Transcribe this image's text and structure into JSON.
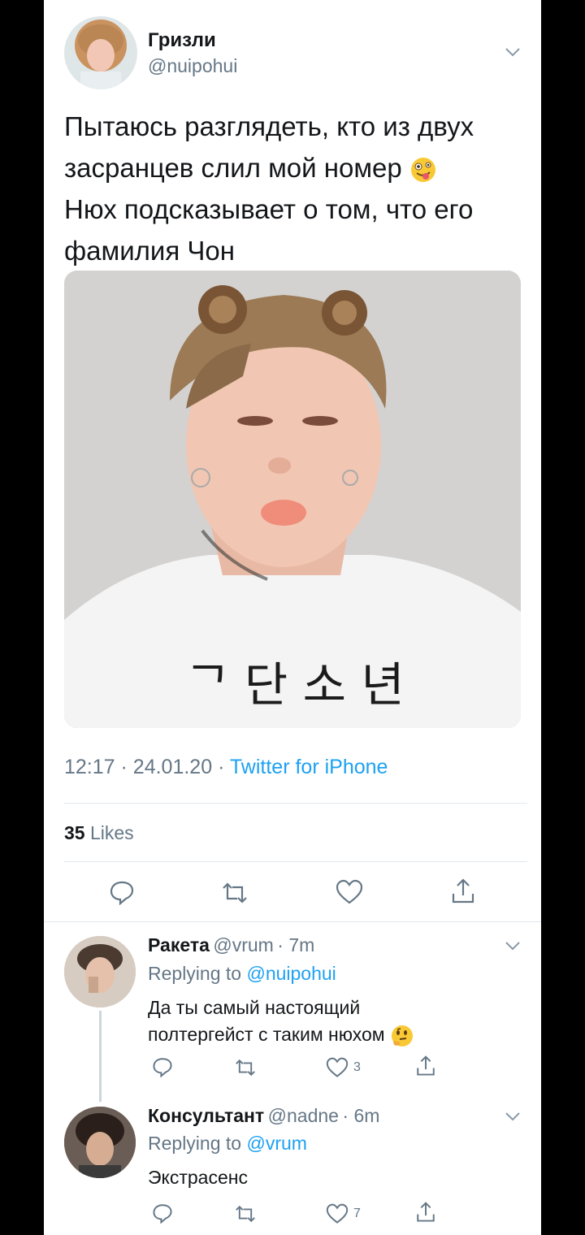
{
  "tweet": {
    "author_name": "Гризли",
    "author_handle": "@nuipohui",
    "text_lines": [
      "Пытаюсь разглядеть, кто из двух",
      "засранцев слил мой номер",
      "Нюх подсказывает о том, что его",
      "фамилия Чон"
    ],
    "time": "12:17",
    "date": "24.01.20",
    "separator": "·",
    "source": "Twitter for iPhone",
    "likes_count": "35",
    "likes_label": "Likes",
    "media_image": "photo-of-person-with-bear-ears",
    "emoji": "zany-face-emoji"
  },
  "replies": [
    {
      "name": "Ракета",
      "handle": "@vrum",
      "time": "· 7m",
      "replying_prefix": "Replying to",
      "replying_to": "@nuipohui",
      "text_lines": [
        "Да ты самый настоящий",
        "полтергейст с таким нюхом"
      ],
      "emoji": "thinking-face-emoji",
      "like_count": "3"
    },
    {
      "name": "Консультант",
      "handle": "@nadne",
      "time": "· 6m",
      "replying_prefix": "Replying to",
      "replying_to": "@vrum",
      "text_lines": [
        "Экстрасенс"
      ],
      "like_count": "7"
    }
  ],
  "colors": {
    "text": "#14171a",
    "secondary": "#657786",
    "accent": "#1da1f2",
    "divider": "#e1e8ed"
  }
}
